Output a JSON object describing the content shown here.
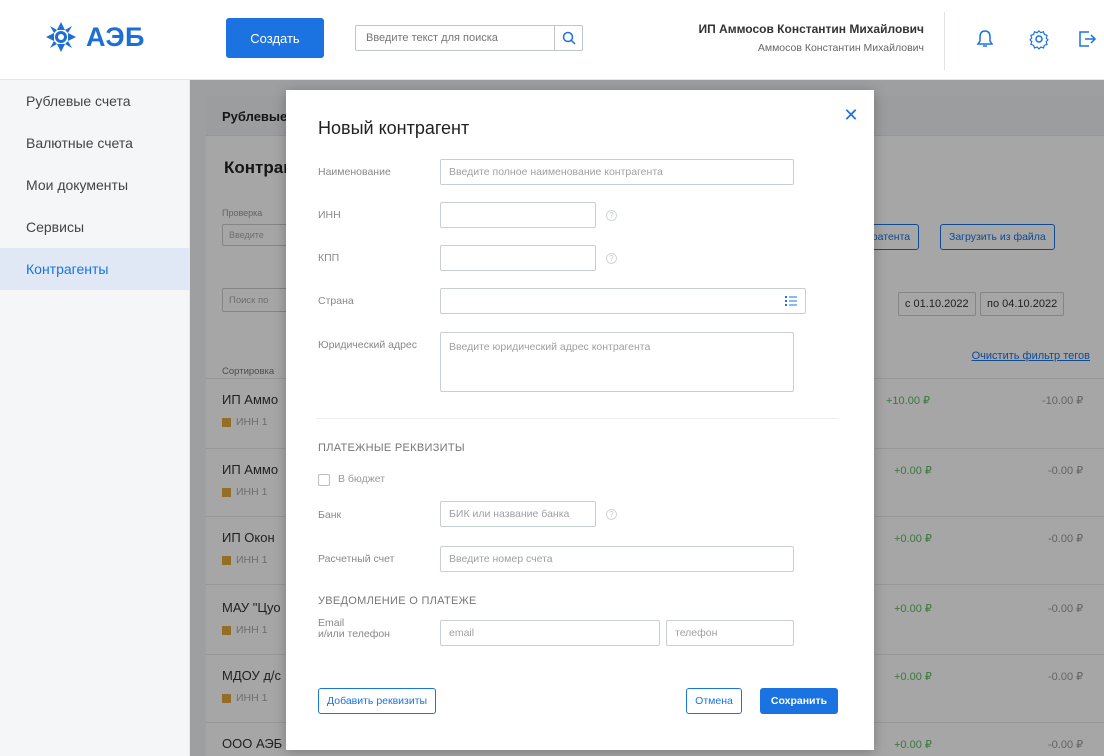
{
  "header": {
    "logo_text": "АЭБ",
    "create_label": "Создать",
    "search_placeholder": "Введите текст для поиска",
    "user_name": "ИП Аммосов Константин Михайлович",
    "user_sub": "Аммосов Константин Михайлович"
  },
  "sidebar": {
    "items": [
      {
        "label": "Рублевые счета"
      },
      {
        "label": "Валютные счета"
      },
      {
        "label": "Мои документы"
      },
      {
        "label": "Сервисы"
      },
      {
        "label": "Контрагенты"
      }
    ]
  },
  "background": {
    "tab": "Рублевые",
    "heading": "Контрагенты",
    "check_label": "Проверка",
    "check_placeholder": "Введите",
    "btn_add": "тратента",
    "btn_upload": "Загрузить из файла",
    "search_placeholder": "Поиск по",
    "date_from": "с 01.10.2022",
    "date_to": "по 04.10.2022",
    "sort_label": "Сортировка",
    "clear_filter": "Очистить фильтр тегов",
    "rows": [
      {
        "name": "ИП Аммо",
        "inn": "ИНН 1",
        "in": "+10.00 ₽",
        "out": "-10.00 ₽"
      },
      {
        "name": "ИП Аммо",
        "inn": "ИНН 1",
        "in": "+0.00 ₽",
        "out": "-0.00 ₽"
      },
      {
        "name": "ИП Окон",
        "inn": "ИНН 1",
        "in": "+0.00 ₽",
        "out": "-0.00 ₽"
      },
      {
        "name": "МАУ \"Цуо",
        "inn": "ИНН 1",
        "in": "+0.00 ₽",
        "out": "-0.00 ₽"
      },
      {
        "name": "МДОУ д/с",
        "inn": "ИНН 1",
        "in": "+0.00 ₽",
        "out": "-0.00 ₽"
      },
      {
        "name": "ООО АЭБ Капитал",
        "inn": "",
        "in": "+0.00 ₽",
        "out": "-0.00 ₽"
      }
    ]
  },
  "modal": {
    "title": "Новый контрагент",
    "name_label": "Наименование",
    "name_placeholder": "Введите полное наименование контрагента",
    "inn_label": "ИНН",
    "kpp_label": "КПП",
    "country_label": "Страна",
    "address_label": "Юридический адрес",
    "address_placeholder": "Введите юридический адрес контрагента",
    "payment_section": "ПЛАТЕЖНЫЕ РЕКВИЗИТЫ",
    "budget_label": "В бюджет",
    "bank_label": "Банк",
    "bank_placeholder": "БИК или название банка",
    "account_label": "Расчетный счет",
    "account_placeholder": "Введите номер счета",
    "notify_section": "УВЕДОМЛЕНИЕ О ПЛАТЕЖЕ",
    "contact_label_1": "Email",
    "contact_label_2": "и/или телефон",
    "email_placeholder": "email",
    "phone_placeholder": "телефон",
    "add_requisites": "Добавить реквизиты",
    "cancel": "Отмена",
    "save": "Сохранить"
  },
  "colors": {
    "accent": "#1a73e0",
    "positive": "#5bb85b",
    "tag": "#e0a93b"
  }
}
